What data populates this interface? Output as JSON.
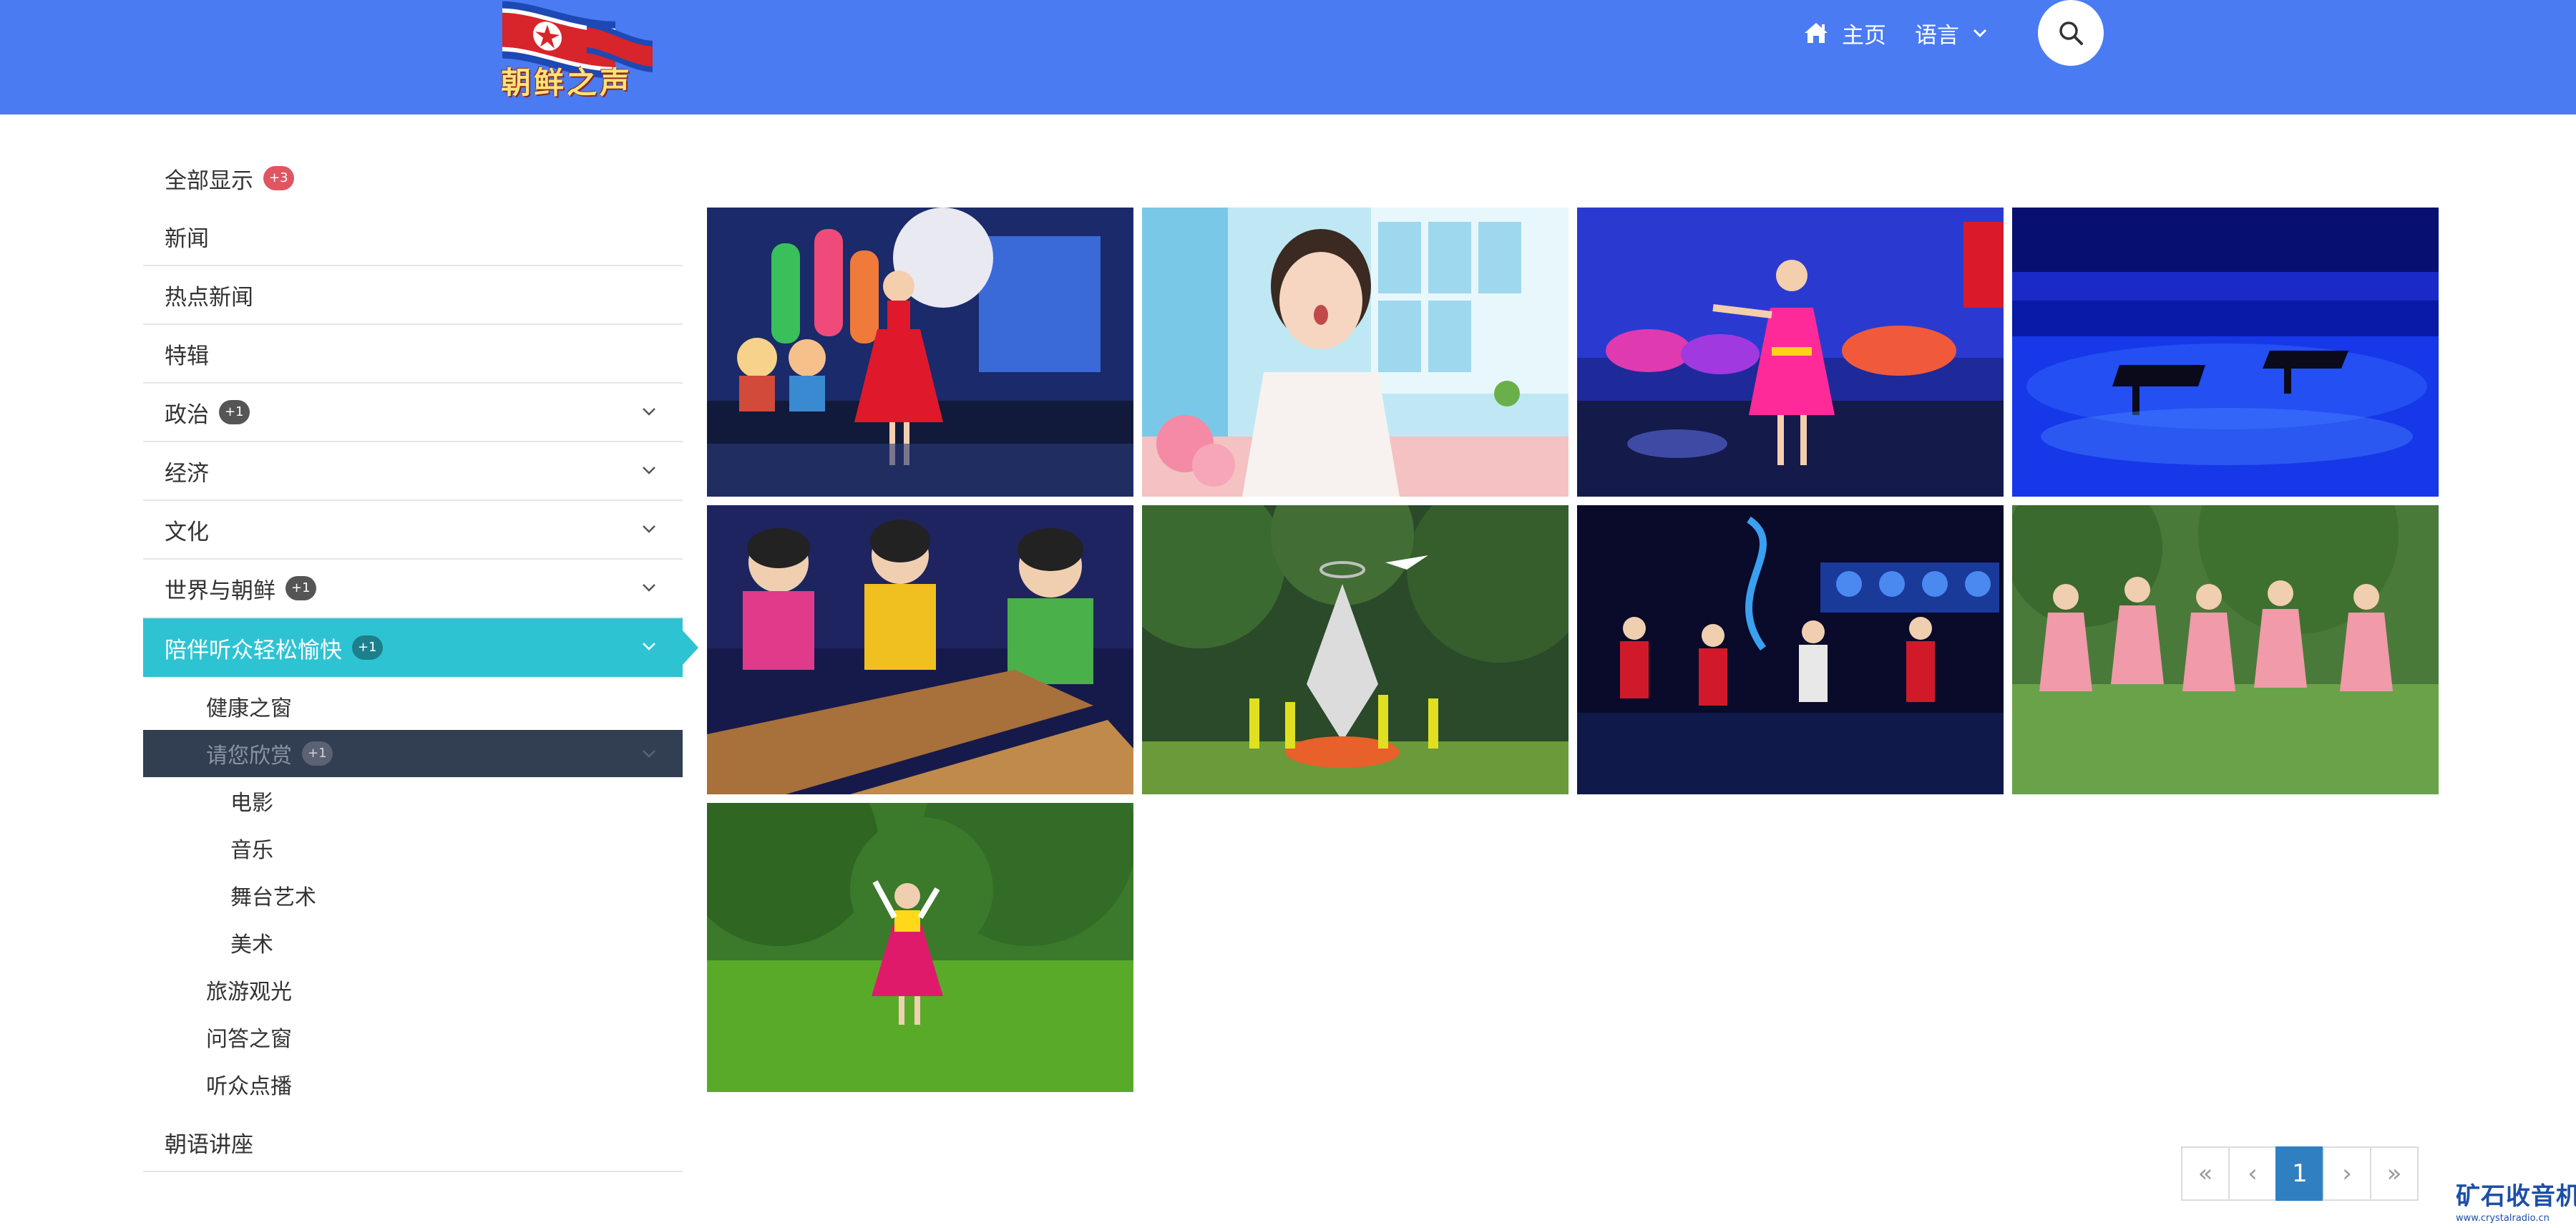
{
  "header": {
    "logo_text": "朝鲜之声",
    "nav": {
      "home_label": "主页",
      "language_label": "语言"
    },
    "colors": {
      "bar": "#4a7bf2"
    }
  },
  "sidebar": {
    "show_all": {
      "label": "全部显示",
      "badge": "+3"
    },
    "items": [
      {
        "label": "新闻"
      },
      {
        "label": "热点新闻"
      },
      {
        "label": "特辑"
      },
      {
        "label": "政治",
        "badge": "+1"
      },
      {
        "label": "经济"
      },
      {
        "label": "文化"
      },
      {
        "label": "世界与朝鲜",
        "badge": "+1"
      },
      {
        "label": "陪伴听众轻松愉快",
        "badge": "+1"
      }
    ],
    "sub_items": [
      {
        "label": "健康之窗"
      },
      {
        "label": "请您欣赏",
        "badge": "+1"
      }
    ],
    "sub_sub_items": [
      {
        "label": "电影"
      },
      {
        "label": "音乐"
      },
      {
        "label": "舞台艺术"
      },
      {
        "label": "美术"
      }
    ],
    "more_sub_items": [
      {
        "label": "旅游观光"
      },
      {
        "label": "问答之窗"
      },
      {
        "label": "听众点播"
      }
    ],
    "bottom_items": [
      {
        "label": "朝语讲座"
      }
    ],
    "active_color": "#2ec3d3",
    "selected_color": "#323e52"
  },
  "gallery": {
    "thumbnails": [
      {
        "scene": "girl-in-red-dress-singing"
      },
      {
        "scene": "girl-in-white-dress-singing"
      },
      {
        "scene": "girl-in-pink-dress-dancing"
      },
      {
        "scene": "piano-concert-blue-stage"
      },
      {
        "scene": "children-playing-gayageum"
      },
      {
        "scene": "outdoor-acrobatics-performance"
      },
      {
        "scene": "children-instrument-ensemble"
      },
      {
        "scene": "girls-in-pink-uniforms-singing"
      },
      {
        "scene": "girl-dancing-on-lawn"
      }
    ]
  },
  "pagination": {
    "first": "«",
    "prev": "‹",
    "current": "1",
    "next": "›",
    "last": "»"
  },
  "watermark": {
    "title": "矿石收音机",
    "url": "www.crystalradio.cn"
  }
}
